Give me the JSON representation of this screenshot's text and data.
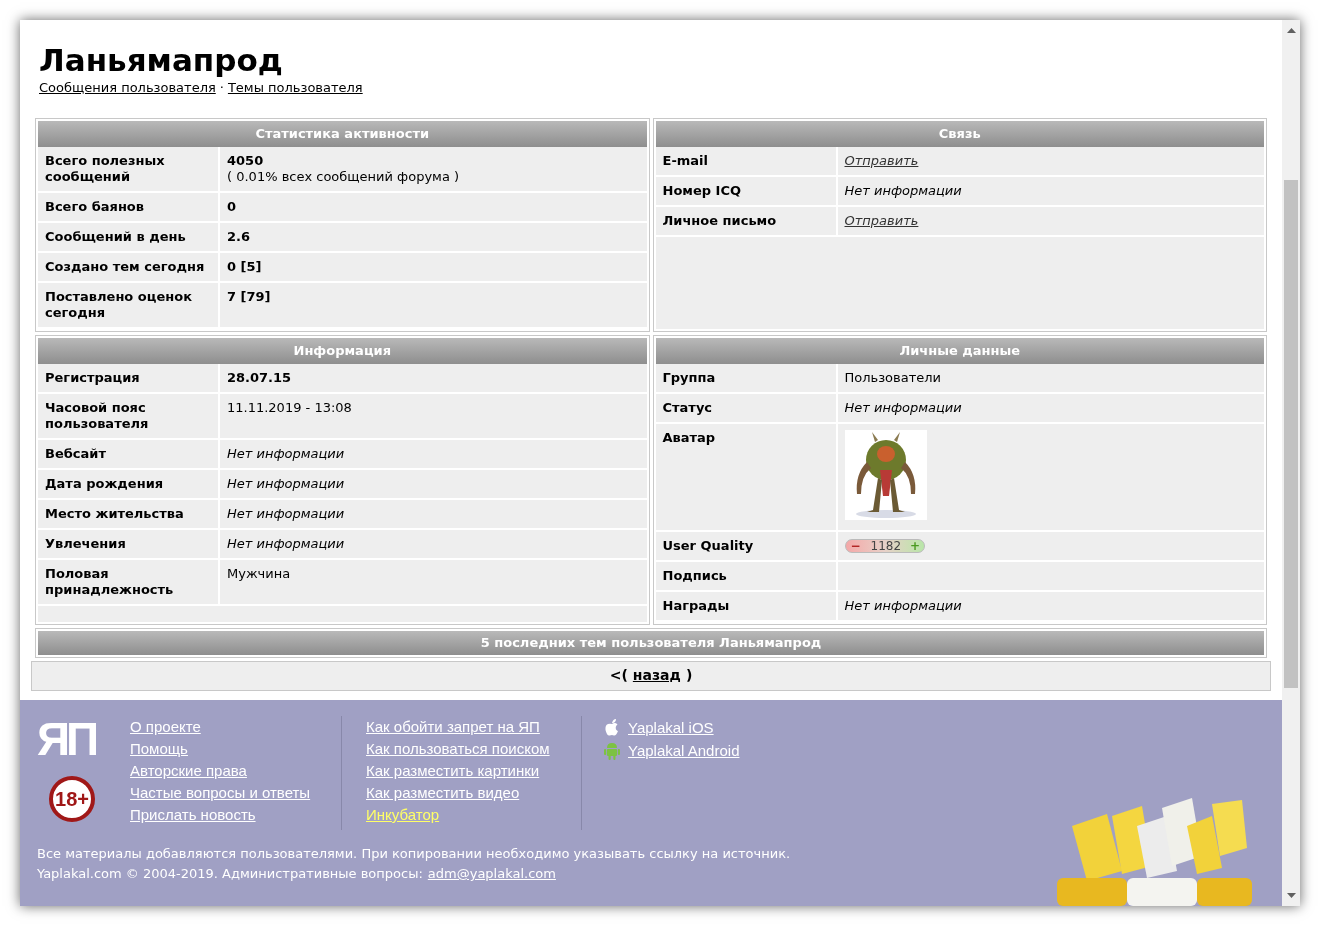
{
  "title": "Ланьямапрод",
  "user_links": [
    "Сообщения пользователя",
    "Темы пользователя"
  ],
  "link_separator": "·",
  "panels": [
    {
      "title": "Статистика активности",
      "rows": [
        {
          "label": "Всего полезных сообщений",
          "kind": "bold",
          "value": "4050",
          "note": "( 0.01% всех сообщений форума )"
        },
        {
          "label": "Всего баянов",
          "kind": "bold",
          "value": "0"
        },
        {
          "label": "Сообщений в день",
          "kind": "bold",
          "value": "2.6"
        },
        {
          "label": "Создано тем сегодня",
          "kind": "bold",
          "value": "0 [5]"
        },
        {
          "label": "Поставлено оценок сегодня",
          "kind": "bold",
          "value": "7 [79]"
        }
      ]
    },
    {
      "title": "Связь",
      "rows": [
        {
          "label": "E-mail",
          "kind": "link",
          "value": "Отправить"
        },
        {
          "label": "Номер ICQ",
          "kind": "italic",
          "value": "Нет информации"
        },
        {
          "label": "Личное письмо",
          "kind": "link",
          "value": "Отправить"
        }
      ]
    },
    {
      "title": "Информация",
      "rows": [
        {
          "label": "Регистрация",
          "kind": "bold",
          "value": "28.07.15"
        },
        {
          "label": "Часовой пояс пользователя",
          "kind": "plain",
          "value": "11.11.2019 - 13:08"
        },
        {
          "label": "Вебсайт",
          "kind": "italic",
          "value": "Нет информации"
        },
        {
          "label": "Дата рождения",
          "kind": "italic",
          "value": "Нет информации"
        },
        {
          "label": "Место жительства",
          "kind": "italic",
          "value": "Нет информации"
        },
        {
          "label": "Увлечения",
          "kind": "italic",
          "value": "Нет информации"
        },
        {
          "label": "Половая принадлежность",
          "kind": "plain",
          "value": "Мужчина"
        }
      ]
    },
    {
      "title": "Личные данные",
      "rows": [
        {
          "label": "Группа",
          "kind": "plain",
          "value": "Пользователи"
        },
        {
          "label": "Статус",
          "kind": "italic",
          "value": "Нет информации"
        },
        {
          "label": "Аватар",
          "kind": "avatar"
        },
        {
          "label": "User Quality",
          "kind": "rating",
          "minus": "−",
          "value": "1182",
          "plus": "+"
        },
        {
          "label": "Подпись",
          "kind": "empty"
        },
        {
          "label": "Награды",
          "kind": "italic",
          "value": "Нет информации"
        }
      ]
    }
  ],
  "recent_topics_title": "5 последних тем пользователя Ланьямапрод",
  "back": {
    "open": "<(",
    "link": "назад",
    "close": ")"
  },
  "footer": {
    "logo": "ЯП",
    "age_badge": "18+",
    "columns": [
      [
        {
          "label": "О проекте",
          "highlight": false
        },
        {
          "label": "Помощь",
          "highlight": false
        },
        {
          "label": "Авторские права",
          "highlight": false
        },
        {
          "label": "Частые вопросы и ответы",
          "highlight": false
        },
        {
          "label": "Прислать новость",
          "highlight": false
        }
      ],
      [
        {
          "label": "Как обойти запрет на ЯП",
          "highlight": false
        },
        {
          "label": "Как пользоваться поиском",
          "highlight": false
        },
        {
          "label": "Как разместить картинки",
          "highlight": false
        },
        {
          "label": "Как разместить видео",
          "highlight": false
        },
        {
          "label": "Инкубатор",
          "highlight": true
        }
      ]
    ],
    "apps": [
      {
        "label": "Yaplakal iOS",
        "kind": "apple"
      },
      {
        "label": "Yaplakal Android",
        "kind": "android"
      }
    ],
    "notice": "Все материалы добавляются пользователями. При копировании необходимо указывать ссылку на источник.",
    "copyright": "Yaplakal.com © 2004-2019. Административные вопросы:",
    "email": "adm@yaplakal.com"
  }
}
